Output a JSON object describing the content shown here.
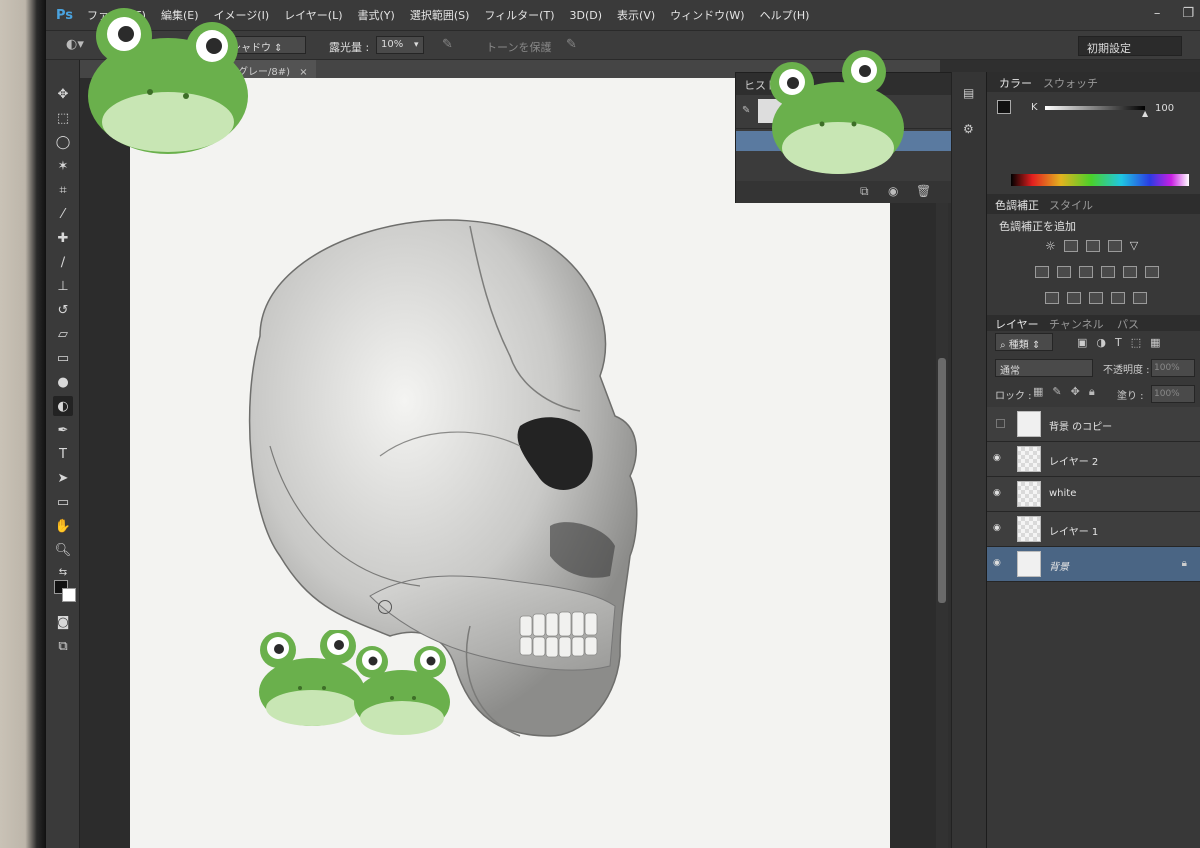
{
  "app": {
    "logo": "Ps"
  },
  "menu": [
    "ファイル(F)",
    "編集(E)",
    "イメージ(I)",
    "レイヤー(L)",
    "書式(Y)",
    "選択範囲(S)",
    "フィルター(T)",
    "3D(D)",
    "表示(V)",
    "ウィンドウ(W)",
    "ヘルプ(H)"
  ],
  "window_controls": {
    "minimize": "–",
    "restore": "❐"
  },
  "options": {
    "range_value": "シャドウ",
    "exposure_label": "露光量 :",
    "exposure_value": "10%",
    "protect_tones": "トーンを保護",
    "workspace": "初期設定"
  },
  "document": {
    "tab_title": "グレー/8#)"
  },
  "history": {
    "title": "ヒスト"
  },
  "color_panel": {
    "tabs": [
      "カラー",
      "スウォッチ"
    ],
    "k_label": "K",
    "k_value": "100"
  },
  "adjustments": {
    "tabs": [
      "色調補正",
      "スタイル"
    ],
    "add_label": "色調補正を追加"
  },
  "layers_panel": {
    "tabs": [
      "レイヤー",
      "チャンネル",
      "パス"
    ],
    "filter_label": "種類",
    "blend_mode": "通常",
    "opacity_label": "不透明度 :",
    "opacity_value": "100%",
    "lock_label": "ロック :",
    "fill_label": "塗り :",
    "fill_value": "100%",
    "layers": [
      {
        "name": "背景 のコピー",
        "visible": false,
        "selected": false,
        "locked": false
      },
      {
        "name": "レイヤー 2",
        "visible": true,
        "selected": false,
        "locked": false
      },
      {
        "name": "white",
        "visible": true,
        "selected": false,
        "locked": false
      },
      {
        "name": "レイヤー 1",
        "visible": true,
        "selected": false,
        "locked": false
      },
      {
        "name": "背景",
        "visible": true,
        "selected": true,
        "locked": true
      }
    ]
  },
  "tools": [
    "move-tool-icon",
    "marquee-tool-icon",
    "lasso-tool-icon",
    "magic-wand-icon",
    "crop-tool-icon",
    "eyedropper-icon",
    "healing-brush-icon",
    "brush-tool-icon",
    "stamp-tool-icon",
    "history-brush-icon",
    "eraser-tool-icon",
    "gradient-tool-icon",
    "blur-tool-icon",
    "dodge-tool-icon",
    "pen-tool-icon",
    "type-tool-icon",
    "path-selection-icon",
    "shape-tool-icon",
    "hand-tool-icon",
    "zoom-tool-icon"
  ],
  "colors": {
    "accent": "#4a6584",
    "frog_green": "#6ab04c",
    "frog_belly": "#c8e6b4"
  }
}
